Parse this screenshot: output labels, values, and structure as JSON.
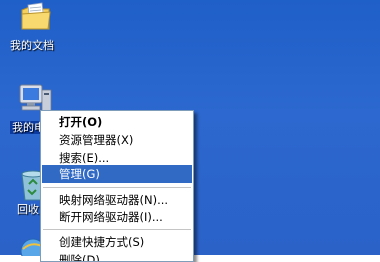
{
  "desktop": {
    "background": "#2a63c9",
    "icons": {
      "my_documents": "我的文档",
      "my_computer": "我的电",
      "recycle_bin": "回收"
    }
  },
  "context_menu": {
    "items": [
      {
        "label": "打开(O)",
        "bold": true
      },
      {
        "label": "资源管理器(X)"
      },
      {
        "label": "搜索(E)..."
      },
      {
        "label": "管理(G)",
        "highlighted": true
      },
      {
        "label": "映射网络驱动器(N)..."
      },
      {
        "label": "断开网络驱动器(I)..."
      },
      {
        "label": "创建快捷方式(S)"
      },
      {
        "label": "删除(D)"
      }
    ],
    "highlight_color": "#316ac5"
  }
}
